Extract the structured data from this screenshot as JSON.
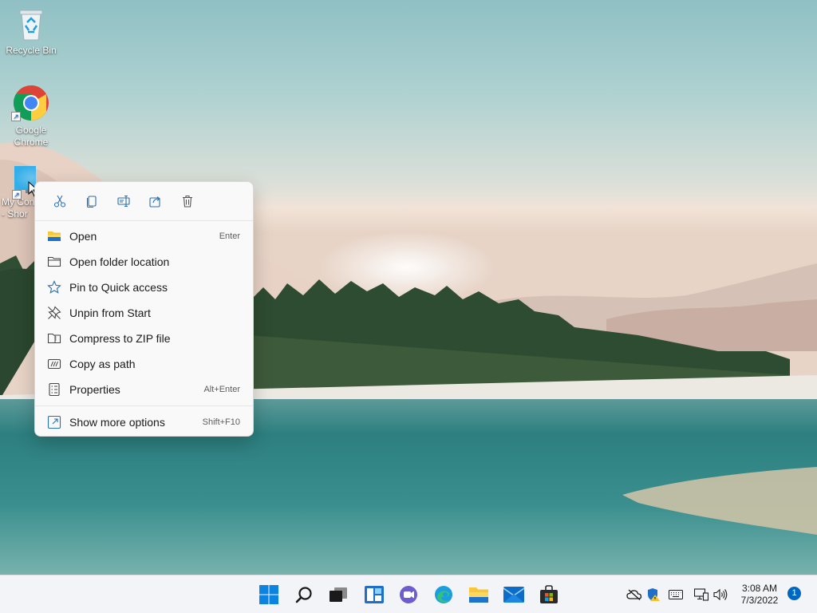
{
  "desktop": {
    "icons": [
      {
        "label": "Recycle Bin",
        "icon": "recycle-bin-icon"
      },
      {
        "label": "Google Chrome",
        "icon": "chrome-icon"
      },
      {
        "label": "My Computer - Shortcut",
        "label_visible": "My Con\n- Shor",
        "icon": "monitor-icon"
      }
    ]
  },
  "context_menu": {
    "toolbar": [
      {
        "name": "cut",
        "icon": "scissors-icon"
      },
      {
        "name": "copy",
        "icon": "copy-icon"
      },
      {
        "name": "rename",
        "icon": "rename-icon"
      },
      {
        "name": "share",
        "icon": "share-icon"
      },
      {
        "name": "delete",
        "icon": "trash-icon"
      }
    ],
    "items": [
      {
        "label": "Open",
        "shortcut": "Enter",
        "icon": "folder-open-icon"
      },
      {
        "label": "Open folder location",
        "shortcut": "",
        "icon": "folder-outline-icon"
      },
      {
        "label": "Pin to Quick access",
        "shortcut": "",
        "icon": "star-icon"
      },
      {
        "label": "Unpin from Start",
        "shortcut": "",
        "icon": "unpin-icon"
      },
      {
        "label": "Compress to ZIP file",
        "shortcut": "",
        "icon": "zip-folder-icon"
      },
      {
        "label": "Copy as path",
        "shortcut": "",
        "icon": "path-icon"
      },
      {
        "label": "Properties",
        "shortcut": "Alt+Enter",
        "icon": "properties-icon"
      },
      {
        "label": "Show more options",
        "shortcut": "Shift+F10",
        "icon": "more-options-icon"
      }
    ]
  },
  "taskbar": {
    "apps": [
      "start-icon",
      "search-icon",
      "task-view-icon",
      "widgets-icon",
      "teams-chat-icon",
      "edge-icon",
      "file-explorer-icon",
      "mail-icon",
      "store-icon"
    ],
    "tray": [
      "onedrive-offline-icon",
      "security-warning-icon",
      "keyboard-icon",
      "network-icon",
      "volume-icon"
    ],
    "time": "3:08 AM",
    "date": "7/3/2022",
    "notification_count": "1"
  },
  "colors": {
    "accent": "#0067c0",
    "menu_bg": "#f9f9f9",
    "taskbar_bg": "#f2f4f7"
  }
}
